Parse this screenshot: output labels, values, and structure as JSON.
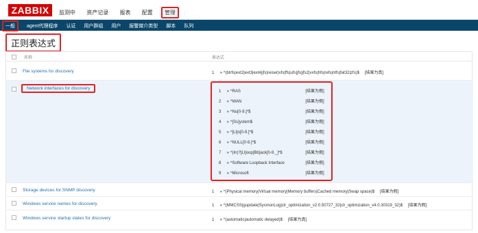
{
  "logo": "ZABBIX",
  "topnav": [
    "监测中",
    "资产记录",
    "报表",
    "配置",
    "管理"
  ],
  "subnav": [
    "一般",
    "agent代理程序",
    "认证",
    "用户群组",
    "用户",
    "报警媒介类型",
    "脚本",
    "队列"
  ],
  "page_title": "正则表达式",
  "table": {
    "col_name": "名称",
    "col_expr": "表达式",
    "rows": [
      {
        "name": "File systems for discovery",
        "expressions": [
          {
            "num": "1",
            "pattern": "^(btrfs|ext2|ext3|ext4|jfs|reiser|xfs|ffs|ufs|jfs|jfs2|vxfs|hfs|refs|ntfs|fat32|zfs)$",
            "result": "[结果为真]"
          }
        ]
      },
      {
        "name": "Network interfaces for discovery",
        "expressions": [
          {
            "num": "1",
            "pattern": "^RAS",
            "result": "[结果为假]"
          },
          {
            "num": "2",
            "pattern": "^WAN",
            "result": "[结果为假]"
          },
          {
            "num": "3",
            "pattern": "^Nu[0-9.]*$",
            "result": "[结果为假]"
          },
          {
            "num": "4",
            "pattern": "^[Ss]ystem$",
            "result": "[结果为假]"
          },
          {
            "num": "5",
            "pattern": "^[Ll]o[0-9.]*$",
            "result": "[结果为假]"
          },
          {
            "num": "6",
            "pattern": "^NULL[0-9.]*$",
            "result": "[结果为假]"
          },
          {
            "num": "7",
            "pattern": "^(In)?[Ll]oop[Bb]ack[0-9._]*$",
            "result": "[结果为假]"
          },
          {
            "num": "8",
            "pattern": "^Software Loopback Interface",
            "result": "[结果为假]"
          },
          {
            "num": "9",
            "pattern": "^Microsoft",
            "result": "[结果为假]"
          }
        ]
      },
      {
        "name": "Storage devices for SNMP discovery",
        "expressions": [
          {
            "num": "1",
            "pattern": "^(Physical memory|Virtual memory|Memory buffers|Cached memory|Swap space)$",
            "result": "[结果为假]"
          }
        ]
      },
      {
        "name": "Windows service names for discovery",
        "expressions": [
          {
            "num": "1",
            "pattern": "^(MMCSS|gupdate|SysmonLog|clr_optimization_v2.0.50727_32|clr_optimization_v4.0.30319_32)$",
            "result": "[结果为假]"
          }
        ]
      },
      {
        "name": "Windows service startup states for discovery",
        "expressions": [
          {
            "num": "1",
            "pattern": "^(automatic|automatic delayed)$",
            "result": "[结果为真]"
          }
        ]
      }
    ]
  },
  "times_sign": "»"
}
